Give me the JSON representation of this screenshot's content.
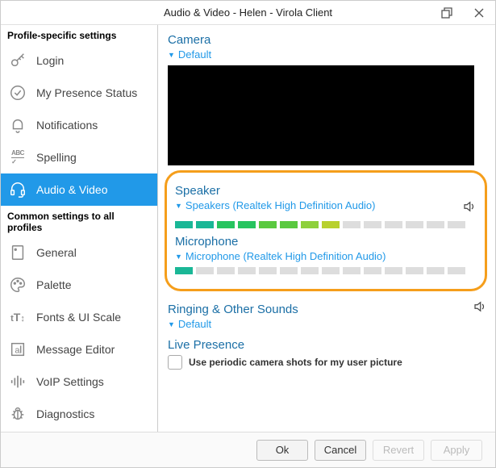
{
  "window": {
    "title": "Audio & Video - Helen - Virola Client"
  },
  "sidebar": {
    "section_profile": "Profile-specific settings",
    "section_common": "Common settings to all profiles",
    "items": [
      {
        "label": "Login"
      },
      {
        "label": "My Presence Status"
      },
      {
        "label": "Notifications"
      },
      {
        "label": "Spelling"
      },
      {
        "label": "Audio & Video"
      },
      {
        "label": "General"
      },
      {
        "label": "Palette"
      },
      {
        "label": "Fonts & UI Scale"
      },
      {
        "label": "Message Editor"
      },
      {
        "label": "VoIP Settings"
      },
      {
        "label": "Diagnostics"
      }
    ]
  },
  "content": {
    "camera": {
      "title": "Camera",
      "selected": "Default"
    },
    "speaker": {
      "title": "Speaker",
      "selected": "Speakers (Realtek High Definition Audio)"
    },
    "microphone": {
      "title": "Microphone",
      "selected": "Microphone (Realtek High Definition Audio)"
    },
    "ringing": {
      "title": "Ringing & Other Sounds",
      "selected": "Default"
    },
    "presence": {
      "title": "Live Presence",
      "checkbox_label": "Use periodic camera shots for my user picture"
    }
  },
  "footer": {
    "ok": "Ok",
    "cancel": "Cancel",
    "revert": "Revert",
    "apply": "Apply"
  }
}
